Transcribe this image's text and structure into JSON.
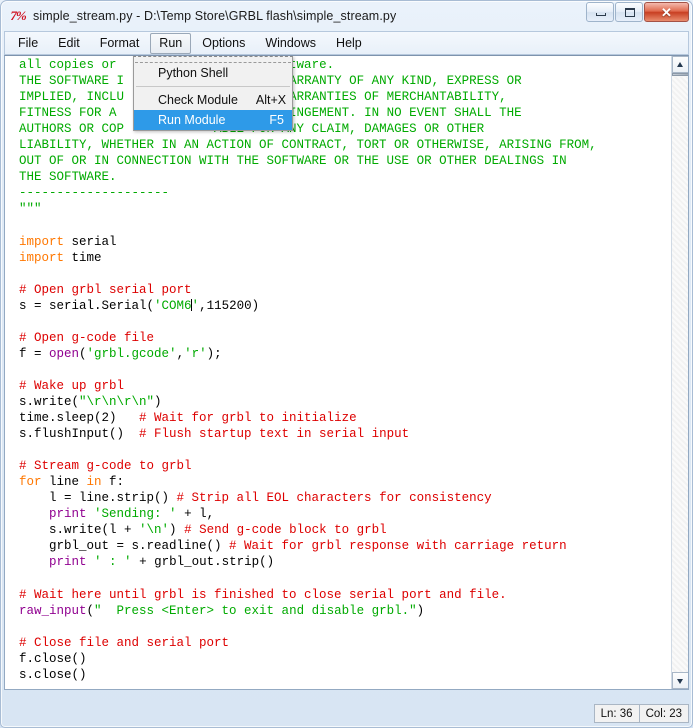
{
  "window": {
    "icon": "python-idle-icon",
    "icon_glyph": "7%",
    "title": "simple_stream.py - D:\\Temp Store\\GRBL flash\\simple_stream.py",
    "minimize_label": "",
    "maximize_label": "",
    "close_label": "✕"
  },
  "menubar": {
    "items": [
      {
        "label": "File",
        "open": false
      },
      {
        "label": "Edit",
        "open": false
      },
      {
        "label": "Format",
        "open": false
      },
      {
        "label": "Run",
        "open": true
      },
      {
        "label": "Options",
        "open": false
      },
      {
        "label": "Windows",
        "open": false
      },
      {
        "label": "Help",
        "open": false
      }
    ]
  },
  "dropdown": {
    "owner": "Run",
    "items": [
      {
        "label": "Python Shell",
        "accel": "",
        "highlighted": false
      },
      {
        "label": "Check Module",
        "accel": "Alt+X",
        "highlighted": false
      },
      {
        "label": "Run Module",
        "accel": "F5",
        "highlighted": true
      }
    ]
  },
  "editor": {
    "lines": [
      [
        {
          "t": "all copies or ",
          "c": "string"
        },
        {
          "t": "            ",
          "c": "plain"
        },
        {
          "t": "of the Software.",
          "c": "string"
        }
      ],
      [
        {
          "t": "THE SOFTWARE I",
          "c": "string"
        },
        {
          "t": "             ",
          "c": "plain"
        },
        {
          "t": "WITHOUT WARRANTY OF ANY KIND, EXPRESS OR",
          "c": "string"
        }
      ],
      [
        {
          "t": "IMPLIED, INCLU",
          "c": "string"
        },
        {
          "t": "              ",
          "c": "plain"
        },
        {
          "t": "TO THE WARRANTIES OF MERCHANTABILITY,",
          "c": "string"
        }
      ],
      [
        {
          "t": "FITNESS FOR A ",
          "c": "string"
        },
        {
          "t": "            ",
          "c": "plain"
        },
        {
          "t": "ND NONINFRINGEMENT. IN NO EVENT SHALL THE",
          "c": "string"
        }
      ],
      [
        {
          "t": "AUTHORS OR COP",
          "c": "string"
        },
        {
          "t": "            ",
          "c": "plain"
        },
        {
          "t": "ABLE FOR ANY CLAIM, DAMAGES OR OTHER",
          "c": "string"
        }
      ],
      [
        {
          "t": "LIABILITY, WHETHER IN AN ACTION OF CONTRACT, TORT OR OTHERWISE, ARISING FROM,",
          "c": "string"
        }
      ],
      [
        {
          "t": "OUT OF OR IN CONNECTION WITH THE SOFTWARE OR THE USE OR OTHER DEALINGS IN",
          "c": "string"
        }
      ],
      [
        {
          "t": "THE SOFTWARE.",
          "c": "string"
        }
      ],
      [
        {
          "t": "--------------------",
          "c": "string"
        }
      ],
      [
        {
          "t": "\"\"\"",
          "c": "string"
        }
      ],
      [
        {
          "t": "",
          "c": "plain"
        }
      ],
      [
        {
          "t": "import",
          "c": "kw"
        },
        {
          "t": " serial",
          "c": "plain"
        }
      ],
      [
        {
          "t": "import",
          "c": "kw"
        },
        {
          "t": " time",
          "c": "plain"
        }
      ],
      [
        {
          "t": "",
          "c": "plain"
        }
      ],
      [
        {
          "t": "# Open grbl serial port",
          "c": "comment"
        }
      ],
      [
        {
          "t": "s = serial.Serial(",
          "c": "plain"
        },
        {
          "t": "'COM6'",
          "c": "string",
          "cursor_after_index": 5
        },
        {
          "t": ",115200)",
          "c": "plain"
        }
      ],
      [
        {
          "t": "",
          "c": "plain"
        }
      ],
      [
        {
          "t": "# Open g-code file",
          "c": "comment"
        }
      ],
      [
        {
          "t": "f = ",
          "c": "plain"
        },
        {
          "t": "open",
          "c": "builtin"
        },
        {
          "t": "(",
          "c": "plain"
        },
        {
          "t": "'grbl.gcode'",
          "c": "string"
        },
        {
          "t": ",",
          "c": "plain"
        },
        {
          "t": "'r'",
          "c": "string"
        },
        {
          "t": ");",
          "c": "plain"
        }
      ],
      [
        {
          "t": "",
          "c": "plain"
        }
      ],
      [
        {
          "t": "# Wake up grbl",
          "c": "comment"
        }
      ],
      [
        {
          "t": "s.write(",
          "c": "plain"
        },
        {
          "t": "\"\\r\\n\\r\\n\"",
          "c": "string"
        },
        {
          "t": ")",
          "c": "plain"
        }
      ],
      [
        {
          "t": "time.sleep(2)   ",
          "c": "plain"
        },
        {
          "t": "# Wait for grbl to initialize",
          "c": "comment"
        }
      ],
      [
        {
          "t": "s.flushInput()  ",
          "c": "plain"
        },
        {
          "t": "# Flush startup text in serial input",
          "c": "comment"
        }
      ],
      [
        {
          "t": "",
          "c": "plain"
        }
      ],
      [
        {
          "t": "# Stream g-code to grbl",
          "c": "comment"
        }
      ],
      [
        {
          "t": "for",
          "c": "kw"
        },
        {
          "t": " line ",
          "c": "plain"
        },
        {
          "t": "in",
          "c": "kw"
        },
        {
          "t": " f:",
          "c": "plain"
        }
      ],
      [
        {
          "t": "    l = line.strip() ",
          "c": "plain"
        },
        {
          "t": "# Strip all EOL characters for consistency",
          "c": "comment"
        }
      ],
      [
        {
          "t": "    ",
          "c": "plain"
        },
        {
          "t": "print",
          "c": "builtin"
        },
        {
          "t": " ",
          "c": "plain"
        },
        {
          "t": "'Sending: '",
          "c": "string"
        },
        {
          "t": " + l,",
          "c": "plain"
        }
      ],
      [
        {
          "t": "    s.write(l + ",
          "c": "plain"
        },
        {
          "t": "'\\n'",
          "c": "string"
        },
        {
          "t": ") ",
          "c": "plain"
        },
        {
          "t": "# Send g-code block to grbl",
          "c": "comment"
        }
      ],
      [
        {
          "t": "    grbl_out = s.readline() ",
          "c": "plain"
        },
        {
          "t": "# Wait for grbl response with carriage return",
          "c": "comment"
        }
      ],
      [
        {
          "t": "    ",
          "c": "plain"
        },
        {
          "t": "print",
          "c": "builtin"
        },
        {
          "t": " ",
          "c": "plain"
        },
        {
          "t": "' : '",
          "c": "string"
        },
        {
          "t": " + grbl_out.strip()",
          "c": "plain"
        }
      ],
      [
        {
          "t": "",
          "c": "plain"
        }
      ],
      [
        {
          "t": "# Wait here until grbl is finished to close serial port and file.",
          "c": "comment"
        }
      ],
      [
        {
          "t": "raw_input",
          "c": "builtin"
        },
        {
          "t": "(",
          "c": "plain"
        },
        {
          "t": "\"  Press <Enter> to exit and disable grbl.\"",
          "c": "string"
        },
        {
          "t": ")",
          "c": "plain"
        }
      ],
      [
        {
          "t": "",
          "c": "plain"
        }
      ],
      [
        {
          "t": "# Close file and serial port",
          "c": "comment"
        }
      ],
      [
        {
          "t": "f.close()",
          "c": "plain"
        }
      ],
      [
        {
          "t": "s.close()",
          "c": "plain"
        }
      ]
    ]
  },
  "scrollbar": {
    "up_arrow": "scroll-up-arrow",
    "down_arrow": "scroll-down-arrow"
  },
  "statusbar": {
    "line": "Ln: 36",
    "column": "Col: 23"
  },
  "colors": {
    "comment": "#dd0000",
    "string": "#00aa00",
    "keyword": "#ff7700",
    "builtin": "#900090",
    "highlight": "#2e9ae8"
  }
}
